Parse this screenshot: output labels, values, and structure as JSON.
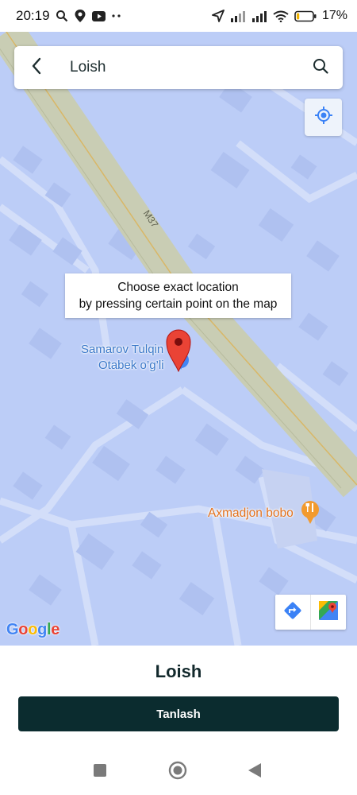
{
  "status_bar": {
    "time": "20:19",
    "battery_percent": "17%",
    "battery_level": 0.17,
    "icons_left": [
      "search-icon",
      "location-pin-icon",
      "youtube-icon",
      "more-dots-icon"
    ],
    "icons_right": [
      "navigation-arrow-icon",
      "signal-icon",
      "signal-icon",
      "wifi-icon",
      "battery-icon"
    ]
  },
  "search": {
    "value": "Loish",
    "back_icon": "chevron-left-icon",
    "search_icon": "search-icon"
  },
  "map": {
    "tooltip_line1": "Choose exact location",
    "tooltip_line2": "by pressing certain point on the map",
    "road_label": "M37",
    "poi_samarov_line1": "Samarov Tulqin",
    "poi_samarov_line2": "Otabek o’g’li",
    "poi_axmadjon": "Axmadjon bobo",
    "google_logo": "Google",
    "locate_icon": "my-location-icon",
    "directions_icon": "directions-icon",
    "maps_app_icon": "google-maps-icon",
    "colors": {
      "background": "#bccdf7",
      "road": "#c9cdb4",
      "road_center": "#d9b766",
      "marker": "#ea4335",
      "poi_blue": "#4285f4",
      "poi_orange": "#f29a2e"
    }
  },
  "bottom": {
    "title": "Loish",
    "select_label": "Tanlash"
  },
  "navbar": {
    "recent_icon": "square-icon",
    "home_icon": "circle-icon",
    "back_icon": "triangle-back-icon"
  }
}
